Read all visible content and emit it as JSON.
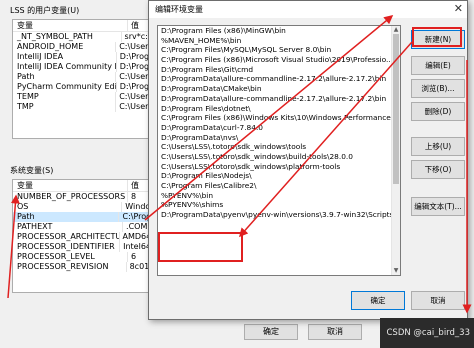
{
  "background": {
    "user_vars_title": "LSS 的用户变量(U)",
    "columns": [
      "变量",
      "值"
    ],
    "user_vars": [
      {
        "name": "_NT_SYMBOL_PATH",
        "value": "srv*c:\\"
      },
      {
        "name": "ANDROID_HOME",
        "value": "C:\\Users"
      },
      {
        "name": "IntelliJ IDEA",
        "value": "D:\\Progr"
      },
      {
        "name": "IntelliJ IDEA Community Edit...",
        "value": "D:\\Progr"
      },
      {
        "name": "Path",
        "value": "C:\\Users"
      },
      {
        "name": "PyCharm Community Edition",
        "value": "D:\\Progr"
      },
      {
        "name": "TEMP",
        "value": "C:\\Users"
      },
      {
        "name": "TMP",
        "value": "C:\\Users"
      }
    ],
    "sys_vars_title": "系统变量(S)",
    "sys_vars": [
      {
        "name": "NUMBER_OF_PROCESSORS",
        "value": "8"
      },
      {
        "name": "OS",
        "value": "Windo"
      },
      {
        "name": "Path",
        "value": "C:\\Prog"
      },
      {
        "name": "PATHEXT",
        "value": ".COM;"
      },
      {
        "name": "PROCESSOR_ARCHITECTURE",
        "value": "AMD64"
      },
      {
        "name": "PROCESSOR_IDENTIFIER",
        "value": "Intel64"
      },
      {
        "name": "PROCESSOR_LEVEL",
        "value": "6"
      },
      {
        "name": "PROCESSOR_REVISION",
        "value": "8c01"
      }
    ],
    "ok_label": "确定",
    "cancel_label": "取消"
  },
  "dialog": {
    "title": "编辑环境变量",
    "close": "✕",
    "items": [
      "D:\\Program Files (x86)\\MinGW\\bin",
      "%MAVEN_HOME%\\bin",
      "C:\\Program Files\\MySQL\\MySQL Server 8.0\\bin",
      "C:\\Program Files (x86)\\Microsoft Visual Studio\\2019\\Professio...",
      "D:\\Program Files\\Git\\cmd",
      "D:\\ProgramData\\allure-commandline-2.17.2\\allure-2.17.2\\bin",
      "D:\\ProgramData\\CMake\\bin",
      "D:\\ProgramData\\allure-commandline-2.17.2\\allure-2.17.2\\bin",
      "D:\\Program Files\\dotnet\\",
      "C:\\Program Files (x86)\\Windows Kits\\10\\Windows Performance...",
      "D:\\ProgramData\\curl-7.84.0",
      "D:\\ProgramData\\nvs\\",
      "C:\\Users\\LSS\\.totoro\\sdk_windows\\tools",
      "C:\\Users\\LSS\\.totoro\\sdk_windows\\build-tools\\28.0.0",
      "C:\\Users\\LSS\\.totoro\\sdk_windows\\platform-tools",
      "D:\\Program Files\\Nodejs\\",
      "C:\\Program Files\\Calibre2\\",
      "%PYENV%\\bin",
      "%PYENV%\\shims",
      "D:\\ProgramData\\pyenv\\pyenv-win\\versions\\3.9.7-win32\\Scripts"
    ],
    "buttons": {
      "new": "新建(N)",
      "edit": "编辑(E)",
      "browse": "浏览(B)...",
      "delete": "删除(D)",
      "move_up": "上移(U)",
      "move_down": "下移(O)",
      "edit_text": "编辑文本(T)..."
    },
    "ok_label": "确定",
    "cancel_label": "取消"
  },
  "watermark": "CSDN @cai_bird_33",
  "colors": {
    "highlight": "#e02020",
    "selection": "#cce8ff",
    "accent": "#0078d7"
  }
}
